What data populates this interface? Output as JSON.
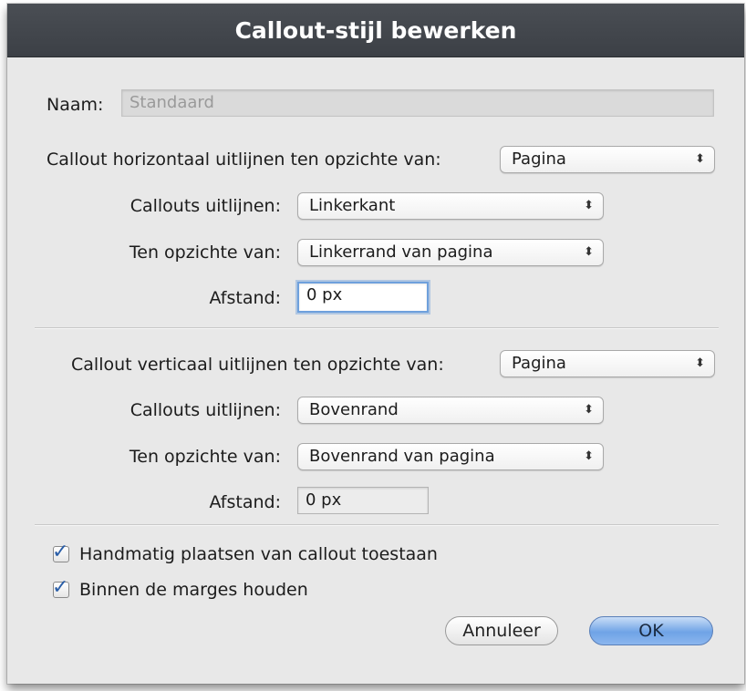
{
  "dialog": {
    "title": "Callout-stijl bewerken"
  },
  "name": {
    "label": "Naam:",
    "value": "Standaard"
  },
  "horizontal": {
    "heading": "Callout horizontaal uitlijnen ten opzichte van:",
    "relative_value": "Pagina",
    "align_label": "Callouts uitlijnen:",
    "align_value": "Linkerkant",
    "relative_to_label": "Ten opzichte van:",
    "relative_to_value": "Linkerrand van pagina",
    "distance_label": "Afstand:",
    "distance_value": "0 px"
  },
  "vertical": {
    "heading": "Callout verticaal uitlijnen ten opzichte van:",
    "relative_value": "Pagina",
    "align_label": "Callouts uitlijnen:",
    "align_value": "Bovenrand",
    "relative_to_label": "Ten opzichte van:",
    "relative_to_value": "Bovenrand van pagina",
    "distance_label": "Afstand:",
    "distance_value": "0 px"
  },
  "options": {
    "manual_placement": {
      "label": "Handmatig plaatsen van callout toestaan",
      "checked": true
    },
    "keep_in_margins": {
      "label": "Binnen de marges houden",
      "checked": true
    }
  },
  "buttons": {
    "cancel": "Annuleer",
    "ok": "OK"
  },
  "icons": {
    "popup_arrows": "updown-chevrons-icon",
    "checkmark": "checkmark-icon"
  },
  "colors": {
    "titlebar": "#3c4046",
    "focus_ring": "#6ea0dc",
    "ok_button": "#6fa3e6"
  }
}
